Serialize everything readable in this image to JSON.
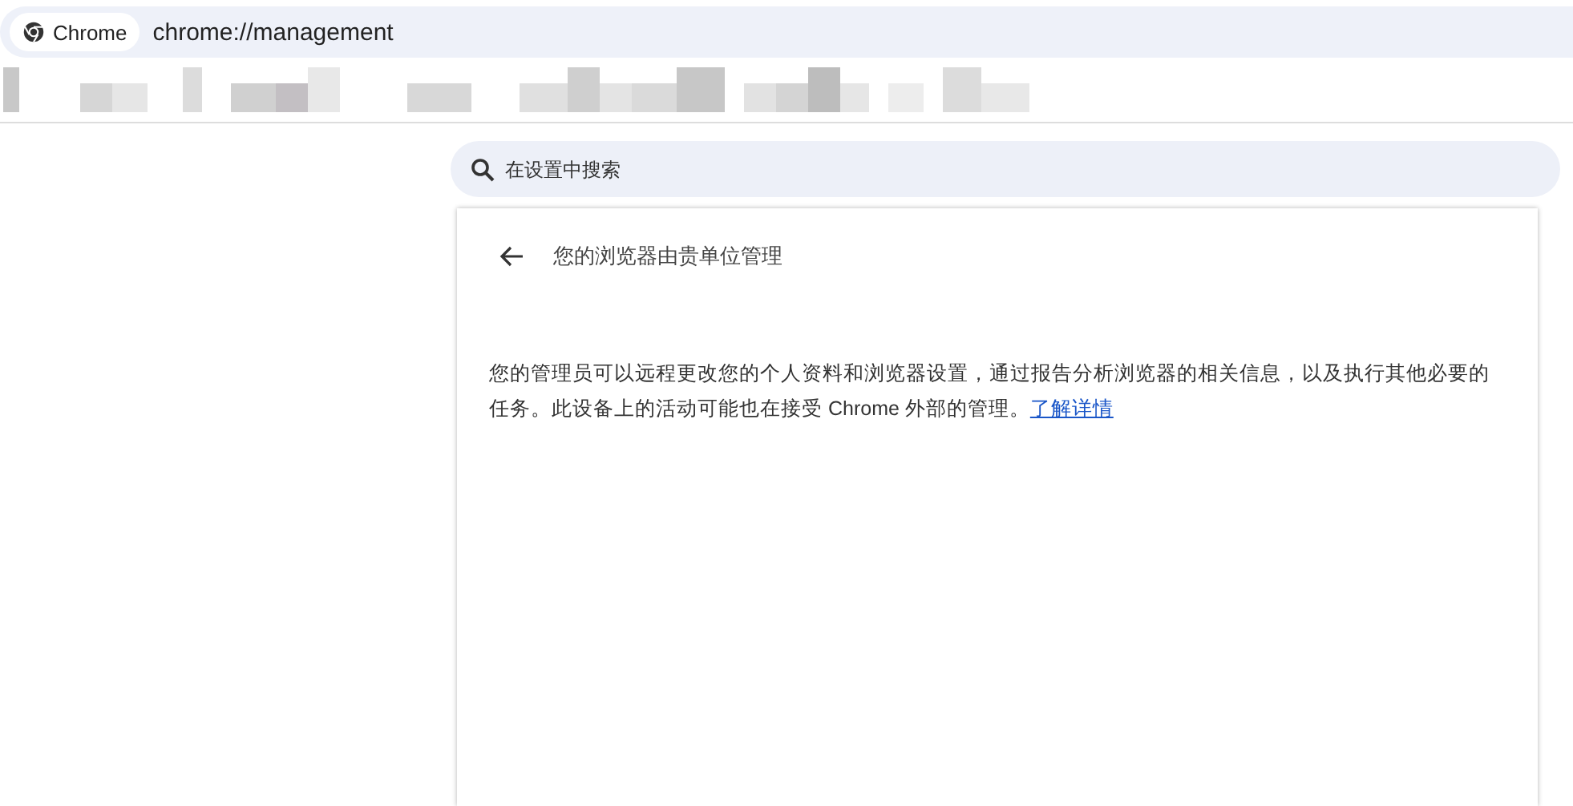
{
  "address_bar": {
    "chip": "Chrome",
    "url": "chrome://management"
  },
  "search": {
    "placeholder": "在设置中搜索"
  },
  "page": {
    "title": "您的浏览器由贵单位管理",
    "description": "您的管理员可以远程更改您的个人资料和浏览器设置，通过报告分析浏览器的相关信息，以及执行其他必要的任务。此设备上的活动可能也在接受 Chrome 外部的管理。",
    "link": "了解详情"
  }
}
